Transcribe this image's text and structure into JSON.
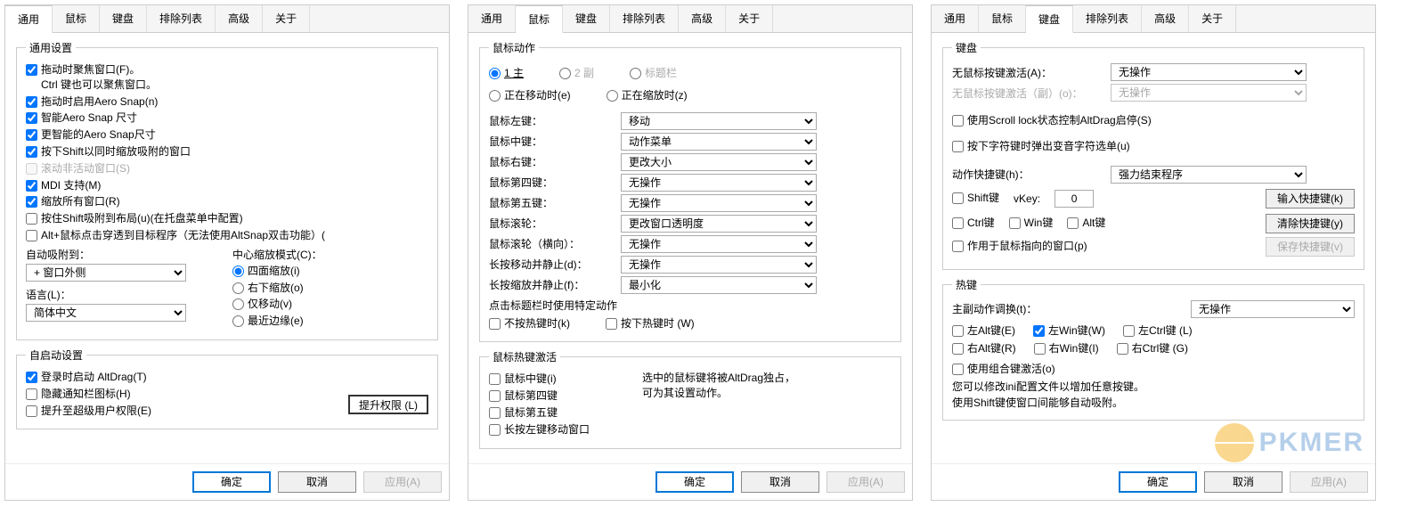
{
  "tabs": {
    "general": "通用",
    "mouse": "鼠标",
    "keyboard": "键盘",
    "blacklist": "排除列表",
    "advanced": "高级",
    "about": "关于"
  },
  "buttons": {
    "ok": "确定",
    "cancel": "取消",
    "apply": "应用(A)",
    "elevate": "提升权限 (L)",
    "input_hotkey": "输入快捷键(k)",
    "clear_hotkey": "清除快捷键(y)",
    "save_hotkey": "保存快捷键(v)"
  },
  "general": {
    "group_title": "通用设置",
    "focus_on_drag_l1": "拖动时聚焦窗口(F)。",
    "focus_on_drag_l2": "Ctrl 键也可以聚焦窗口。",
    "aero_snap": "拖动时启用Aero Snap(n)",
    "smart_aero": "智能Aero Snap 尺寸",
    "smarter_aero": "更智能的Aero Snap尺寸",
    "shift_resize": "按下Shift以同时缩放吸附的窗口",
    "scroll_inactive": "滚动非活动窗口(S)",
    "mdi": "MDI 支持(M)",
    "resize_all": "缩放所有窗口(R)",
    "shift_snap_layout": "按住Shift吸附到布局(u)(在托盘菜单中配置)",
    "alt_click_through": "Alt+鼠标点击穿透到目标程序（无法使用AltSnap双击功能）(",
    "auto_snap_label": "自动吸附到：",
    "auto_snap_value": "+ 窗口外侧",
    "center_mode_label": "中心缩放模式(C)：",
    "center_mode_opts": {
      "four_side": "四面缩放(i)",
      "bottom_right": "右下缩放(o)",
      "move_only": "仅移动(v)",
      "closest_edge": "最近边缘(e)"
    },
    "language_label": "语言(L)：",
    "language_value": "简体中文",
    "autostart_group": "自启动设置",
    "autostart_login": "登录时启动 AltDrag(T)",
    "hide_tray": "隐藏通知栏图标(H)",
    "elevate_super": "提升至超级用户权限(E)"
  },
  "mouse": {
    "actions_group": "鼠标动作",
    "radio_primary": "1 主",
    "radio_secondary": "2 副",
    "radio_titlebar": "标题栏",
    "while_moving": "正在移动时(e)",
    "while_resizing": "正在缩放时(z)",
    "left": "鼠标左键：",
    "middle": "鼠标中键：",
    "right": "鼠标右键：",
    "mb4": "鼠标第四键：",
    "mb5": "鼠标第五键：",
    "wheel": "鼠标滚轮：",
    "hwheel": "鼠标滚轮（横向）：",
    "long_move": "长按移动并静止(d)：",
    "long_resize": "长按缩放并静止(f)：",
    "titlebar_note": "点击标题栏时使用特定动作",
    "wo_hotkey": "不按热键时(k)",
    "with_hotkey": "按下热键时 (W)",
    "opts": {
      "move": "移动",
      "action_menu": "动作菜单",
      "resize": "更改大小",
      "nothing": "无操作",
      "transparency": "更改窗口透明度",
      "minimize": "最小化"
    },
    "hotkey_group": "鼠标热键激活",
    "hotkey_note_l1": "选中的鼠标键将被AltDrag独占，",
    "hotkey_note_l2": "可为其设置动作。",
    "hk_middle": "鼠标中键(i)",
    "hk_mb4": "鼠标第四键",
    "hk_mb5": "鼠标第五键",
    "hk_long_left": "长按左键移动窗口"
  },
  "keyboard": {
    "kb_group": "键盘",
    "activate_no_mouse": "无鼠标按键激活(A)：",
    "activate_no_mouse_sec": "无鼠标按键激活（副）(o)：",
    "opt_nothing": "无操作",
    "scroll_lock": "使用Scroll lock状态控制AltDrag启停(S)",
    "char_key_popup": "按下字符键时弹出变音字符选单(u)",
    "action_hotkey_label": "动作快捷键(h)：",
    "action_hotkey_value": "强力结束程序",
    "shift": "Shift键",
    "ctrl": "Ctrl键",
    "win": "Win键",
    "alt": "Alt键",
    "vkey_label": "vKey:",
    "vkey_value": "0",
    "apply_to_pointed": "作用于鼠标指向的窗口(p)",
    "hotkey_group": "热键",
    "main_sec_toggle": "主副动作调换(t)：",
    "left_alt": "左Alt键(E)",
    "right_alt": "右Alt键(R)",
    "left_win": "左Win键(W)",
    "right_win": "右Win键(I)",
    "left_ctrl": "左Ctrl键 (L)",
    "right_ctrl": "右Ctrl键 (G)",
    "combo_activate": "使用组合键激活(o)",
    "note_l1": "您可以修改ini配置文件以增加任意按键。",
    "note_l2": "使用Shift键使窗口间能够自动吸附。"
  },
  "watermark": "PKMER"
}
